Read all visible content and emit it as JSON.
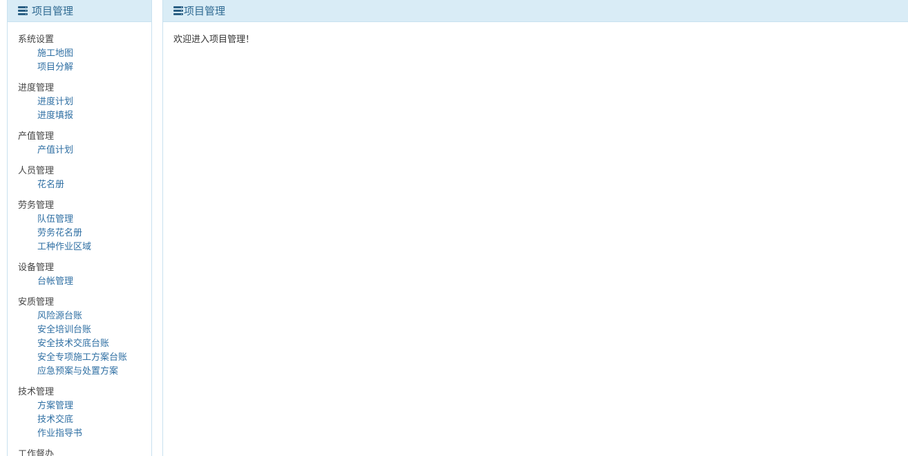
{
  "sidebar": {
    "title": "项目管理",
    "icon": "server-stack-icon",
    "groups": [
      {
        "title": "系统设置",
        "items": [
          "施工地图",
          "项目分解"
        ]
      },
      {
        "title": "进度管理",
        "items": [
          "进度计划",
          "进度填报"
        ]
      },
      {
        "title": "产值管理",
        "items": [
          "产值计划"
        ]
      },
      {
        "title": "人员管理",
        "items": [
          "花名册"
        ]
      },
      {
        "title": "劳务管理",
        "items": [
          "队伍管理",
          "劳务花名册",
          "工种作业区域"
        ]
      },
      {
        "title": "设备管理",
        "items": [
          "台帐管理"
        ]
      },
      {
        "title": "安质管理",
        "items": [
          "风险源台账",
          "安全培训台账",
          "安全技术交底台账",
          "安全专项施工方案台账",
          "应急预案与处置方案"
        ]
      },
      {
        "title": "技术管理",
        "items": [
          "方案管理",
          "技术交底",
          "作业指导书"
        ]
      },
      {
        "title": "工作督办",
        "items": []
      }
    ]
  },
  "main": {
    "title": "项目管理",
    "icon": "server-stack-icon",
    "welcome": "欢迎进入项目管理！"
  },
  "colors": {
    "header_bg": "#d9ecf6",
    "border": "#c8e1ef",
    "link": "#2f6fa3",
    "header_text": "#2f6a92"
  }
}
